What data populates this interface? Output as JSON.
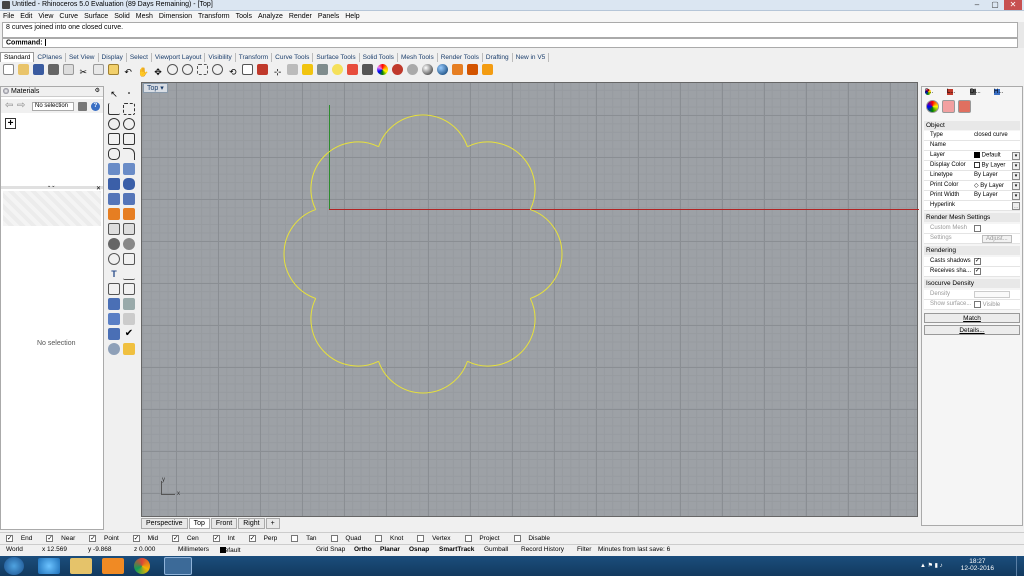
{
  "window": {
    "title": "Untitled - Rhinoceros 5.0 Evaluation (89 Days Remaining) - [Top]",
    "min": "–",
    "max": "▢",
    "close": "✕"
  },
  "menu": [
    "File",
    "Edit",
    "View",
    "Curve",
    "Surface",
    "Solid",
    "Mesh",
    "Dimension",
    "Transform",
    "Tools",
    "Analyze",
    "Render",
    "Panels",
    "Help"
  ],
  "command": {
    "history": "8 curves joined into one closed curve.",
    "prompt": "Command:"
  },
  "toolbar_tabs": [
    "Standard",
    "CPlanes",
    "Set View",
    "Display",
    "Select",
    "Viewport Layout",
    "Visibility",
    "Transform",
    "Curve Tools",
    "Surface Tools",
    "Solid Tools",
    "Mesh Tools",
    "Render Tools",
    "Drafting",
    "New in V5"
  ],
  "left_panel": {
    "title": "Materials",
    "selector": "No selection",
    "empty_text": "No selection",
    "back": "⇦",
    "forward": "⇨",
    "add": "+",
    "collapse": "⌄⌄",
    "close": "✕",
    "help": "?"
  },
  "viewport": {
    "label": "Top",
    "dropdown": "▾",
    "axis_x": "x",
    "axis_y": "y"
  },
  "viewport_tabs": [
    "Perspective",
    "Top",
    "Front",
    "Right",
    "+"
  ],
  "right_panel": {
    "tabs": [
      "P...",
      "L...",
      "Di...",
      "H..."
    ],
    "sections": {
      "object": "Object",
      "mesh": "Render Mesh Settings",
      "rendering": "Rendering",
      "iso": "Isocurve Density"
    },
    "props": [
      {
        "key": "Type",
        "value": "closed curve"
      },
      {
        "key": "Name",
        "value": ""
      },
      {
        "key": "Layer",
        "value": "Default"
      },
      {
        "key": "Display Color",
        "value": "By Layer"
      },
      {
        "key": "Linetype",
        "value": "By Layer"
      },
      {
        "key": "Print Color",
        "value": "By Layer"
      },
      {
        "key": "Print Width",
        "value": "By Layer"
      },
      {
        "key": "Hyperlink",
        "value": ""
      }
    ],
    "mesh": {
      "custom": "Custom Mesh",
      "settings": "Settings",
      "adjust": "Adjust..."
    },
    "rendering": {
      "casts": "Casts shadows",
      "receives": "Receives sha..."
    },
    "iso": {
      "density": "Density",
      "show": "Show surface...",
      "visible": "Visible"
    },
    "buttons": {
      "match": "Match",
      "details": "Details..."
    }
  },
  "osnap": [
    {
      "label": "End",
      "checked": true
    },
    {
      "label": "Near",
      "checked": true
    },
    {
      "label": "Point",
      "checked": true
    },
    {
      "label": "Mid",
      "checked": true
    },
    {
      "label": "Cen",
      "checked": true
    },
    {
      "label": "Int",
      "checked": true
    },
    {
      "label": "Perp",
      "checked": true
    },
    {
      "label": "Tan",
      "checked": false
    },
    {
      "label": "Quad",
      "checked": false
    },
    {
      "label": "Knot",
      "checked": false
    },
    {
      "label": "Vertex",
      "checked": false
    },
    {
      "label": "Project",
      "checked": false
    },
    {
      "label": "Disable",
      "checked": false
    }
  ],
  "status": {
    "cplane": "World",
    "x": "x 12.569",
    "y": "y -9.868",
    "z": "z 0.000",
    "units": "Millimeters",
    "layer": "Default",
    "toggles": [
      "Grid Snap",
      "Ortho",
      "Planar",
      "Osnap",
      "SmartTrack",
      "Gumball",
      "Record History",
      "Filter"
    ],
    "save": "Minutes from last save: 6"
  },
  "clock": {
    "time": "18:27",
    "date": "12-02-2016"
  },
  "colors": {
    "curve": "#e8e23a",
    "x_axis": "#b22222",
    "y_axis": "#2e8b2e",
    "viewport_bg": "#9da1a6",
    "taskbar": "#1b4d7c"
  }
}
